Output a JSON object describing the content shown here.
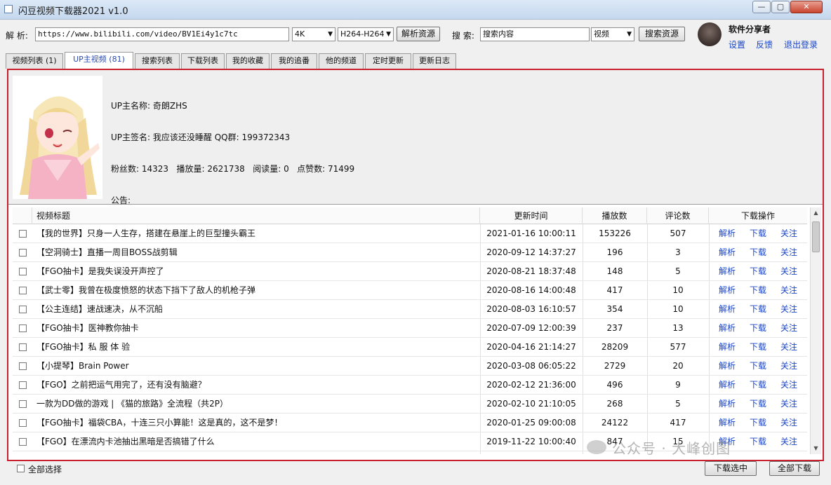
{
  "window": {
    "title": "闪豆视频下载器2021 v1.0",
    "min": "—",
    "max": "▢",
    "close": "✕"
  },
  "toolbar": {
    "parse_label": "解 析:",
    "url_value": "https://www.bilibili.com/video/BV1Ei4y1c7tc",
    "quality": "4K",
    "codec": "H264-H264",
    "parse_button": "解析资源",
    "search_label": "搜 索:",
    "search_placeholder": "搜索内容",
    "search_type": "视频",
    "search_button": "搜索资源"
  },
  "user": {
    "name": "软件分享者",
    "settings": "设置",
    "feedback": "反馈",
    "logout": "退出登录"
  },
  "tabs": [
    "视频列表 (1)",
    "UP主视频 (81)",
    "搜索列表",
    "下载列表",
    "我的收藏",
    "我的追番",
    "他的频道",
    "定时更新",
    "更新日志"
  ],
  "profile": {
    "line1": "UP主名称: 奇朗ZHS",
    "line2": "UP主签名: 我应该还没睡醒 QQ群: 199372343",
    "line3": "粉丝数: 14323   播放量: 2621738   阅读量: 0   点赞数: 71499",
    "line4": "公告:"
  },
  "table": {
    "headers": [
      "视频标题",
      "更新时间",
      "播放数",
      "评论数",
      "下载操作"
    ],
    "action_labels": [
      "解析",
      "下载",
      "关注"
    ],
    "rows": [
      {
        "title": "【我的世界】只身一人生存，搭建在悬崖上的巨型撞头霸王",
        "time": "2021-01-16 10:00:11",
        "plays": "153226",
        "comments": "507"
      },
      {
        "title": "【空洞骑士】直播一周目BOSS战剪辑",
        "time": "2020-09-12 14:37:27",
        "plays": "196",
        "comments": "3"
      },
      {
        "title": "【FGO抽卡】是我失误没开声控了",
        "time": "2020-08-21 18:37:48",
        "plays": "148",
        "comments": "5"
      },
      {
        "title": "【武士零】我曾在极度愤怒的状态下挡下了敌人的机枪子弹",
        "time": "2020-08-16 14:00:48",
        "plays": "417",
        "comments": "10"
      },
      {
        "title": "【公主连结】速战速决，从不沉船",
        "time": "2020-08-03 16:10:57",
        "plays": "354",
        "comments": "10"
      },
      {
        "title": "【FGO抽卡】医神教你抽卡",
        "time": "2020-07-09 12:00:39",
        "plays": "237",
        "comments": "13"
      },
      {
        "title": "【FGO抽卡】私 服 体 验",
        "time": "2020-04-16 21:14:27",
        "plays": "28209",
        "comments": "577"
      },
      {
        "title": "【小提琴】Brain Power",
        "time": "2020-03-08 06:05:22",
        "plays": "2729",
        "comments": "20"
      },
      {
        "title": "【FGO】之前把运气用完了，还有没有脑避？",
        "time": "2020-02-12 21:36:00",
        "plays": "496",
        "comments": "9"
      },
      {
        "title": "一款为DD做的游戏 | 《猫的旅路》全流程（共2P）",
        "time": "2020-02-10 21:10:05",
        "plays": "268",
        "comments": "5"
      },
      {
        "title": "【FGO抽卡】福袋CBA，十连三只小算能！这是真的，这不是梦！",
        "time": "2020-01-25 09:00:08",
        "plays": "24122",
        "comments": "417"
      },
      {
        "title": "【FGO】在漂流内卡池抽出黑暗是否搞错了什么",
        "time": "2019-11-22 10:00:40",
        "plays": "847",
        "comments": "15"
      }
    ]
  },
  "footer": {
    "select_all": "全部选择",
    "download_selected": "下载选中",
    "download_all": "全部下载"
  },
  "watermark": "公众号 · 大峰创图"
}
